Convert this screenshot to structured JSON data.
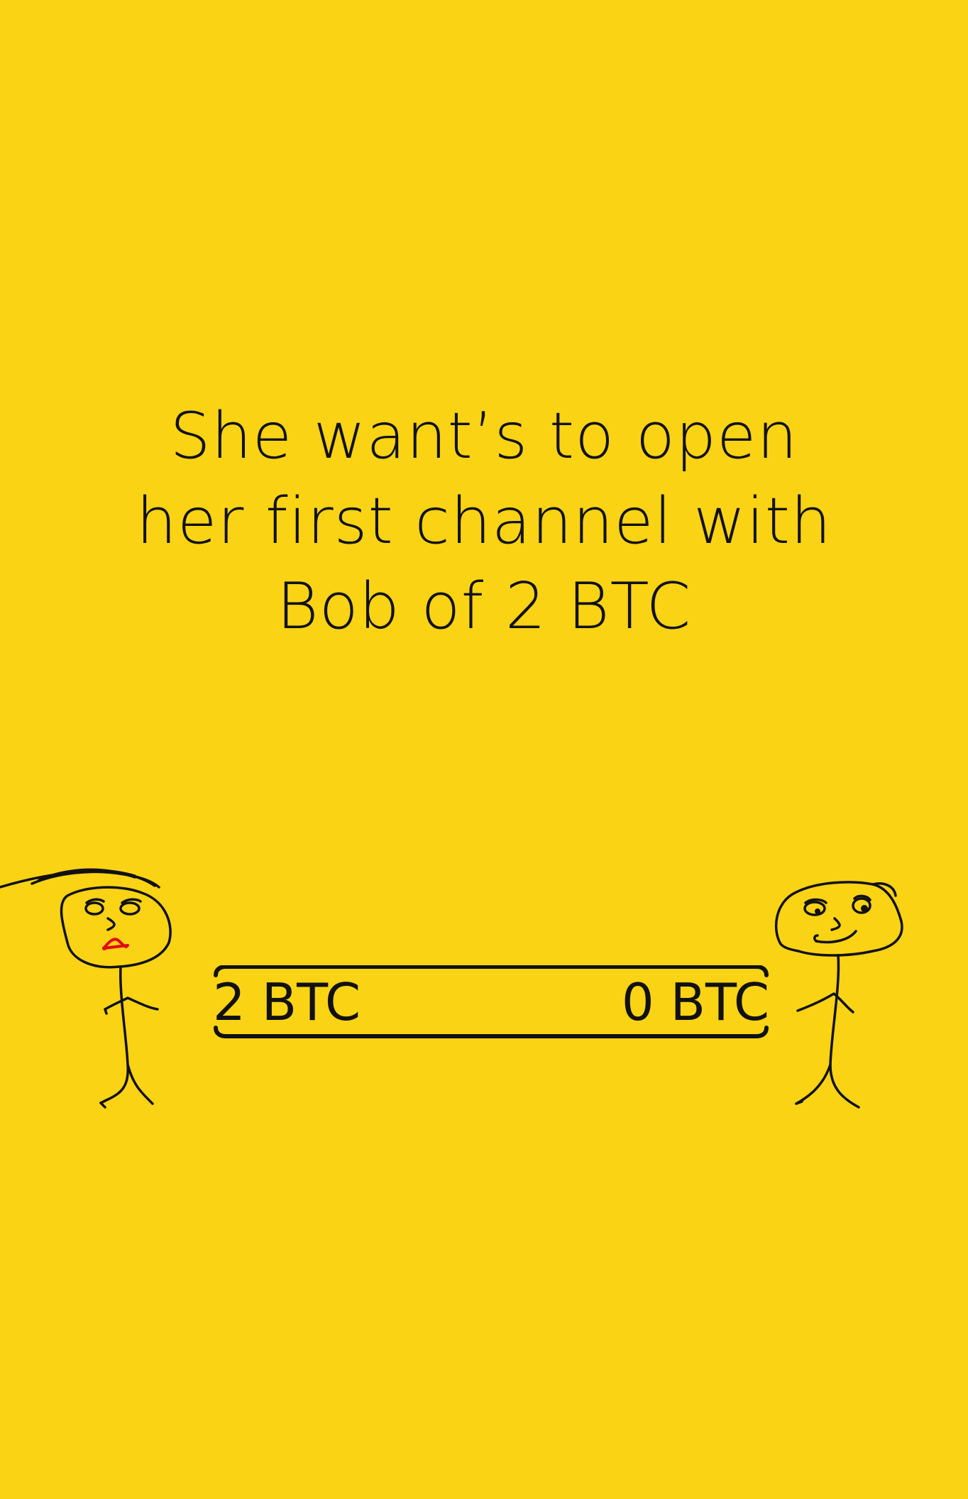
{
  "colors": {
    "background": "#FAD314",
    "ink": "#111111",
    "alice_mouth": "#E3001B"
  },
  "caption": {
    "lines": [
      "She want’s to open",
      "her first channel with",
      "Bob of 2 BTC"
    ]
  },
  "channel": {
    "left_balance": "2 BTC",
    "right_balance": "0 BTC"
  },
  "figures": {
    "alice": "stick-figure-alice",
    "bob": "stick-figure-bob"
  }
}
